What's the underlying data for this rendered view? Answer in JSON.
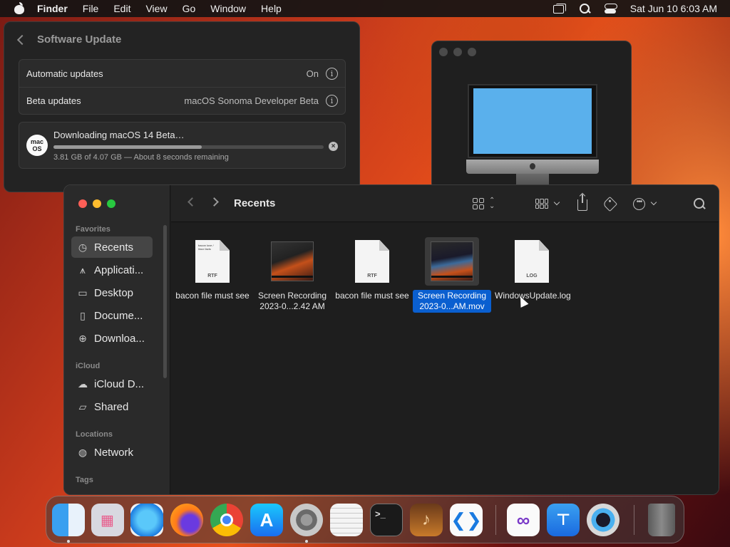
{
  "menubar": {
    "app_name": "Finder",
    "menus": [
      "File",
      "Edit",
      "View",
      "Go",
      "Window",
      "Help"
    ],
    "clock": "Sat Jun 10  6:03 AM"
  },
  "software_update": {
    "title": "Software Update",
    "automatic_updates": {
      "label": "Automatic updates",
      "value": "On"
    },
    "beta_updates": {
      "label": "Beta updates",
      "value": "macOS Sonoma Developer Beta"
    },
    "download": {
      "badge": "mac OS",
      "title": "Downloading macOS 14 Beta…",
      "progress_fraction": 0.55,
      "status": "3.81 GB of 4.07 GB — About 8 seconds remaining"
    }
  },
  "finder": {
    "title": "Recents",
    "sidebar": {
      "favorites_header": "Favorites",
      "favorites": [
        {
          "label": "Recents",
          "icon": "clock-icon"
        },
        {
          "label": "Applicati...",
          "icon": "applications-icon"
        },
        {
          "label": "Desktop",
          "icon": "desktop-icon"
        },
        {
          "label": "Docume...",
          "icon": "document-icon"
        },
        {
          "label": "Downloa...",
          "icon": "download-icon"
        }
      ],
      "icloud_header": "iCloud",
      "icloud": [
        {
          "label": "iCloud D...",
          "icon": "cloud-icon"
        },
        {
          "label": "Shared",
          "icon": "shared-folder-icon"
        }
      ],
      "locations_header": "Locations",
      "locations": [
        {
          "label": "Network",
          "icon": "globe-icon"
        }
      ],
      "tags_header": "Tags"
    },
    "files": [
      {
        "name": "bacon file must see",
        "kind": "RTF",
        "preview_text": "bacon love / linux facts"
      },
      {
        "name": "Screen Recording 2023-0...2.42 AM",
        "kind": "video"
      },
      {
        "name": "bacon file must see",
        "kind": "RTF"
      },
      {
        "name": "Screen Recording 2023-0...AM.mov",
        "kind": "video",
        "selected": true
      },
      {
        "name": "WindowsUpdate.log",
        "kind": "LOG"
      }
    ]
  },
  "dock": {
    "apps": [
      "Finder",
      "Launchpad",
      "Safari",
      "Firefox",
      "Chrome",
      "App Store",
      "System Settings",
      "TextEdit",
      "Terminal",
      "GarageBand",
      "Visual Studio Code",
      "Visual Studio",
      "Keynote",
      "QuickTime Player",
      "Trash"
    ]
  },
  "colors": {
    "selection_blue": "#0a5fd0",
    "traffic_red": "#fe5f57",
    "traffic_yellow": "#febc2e",
    "traffic_green": "#28c840"
  }
}
